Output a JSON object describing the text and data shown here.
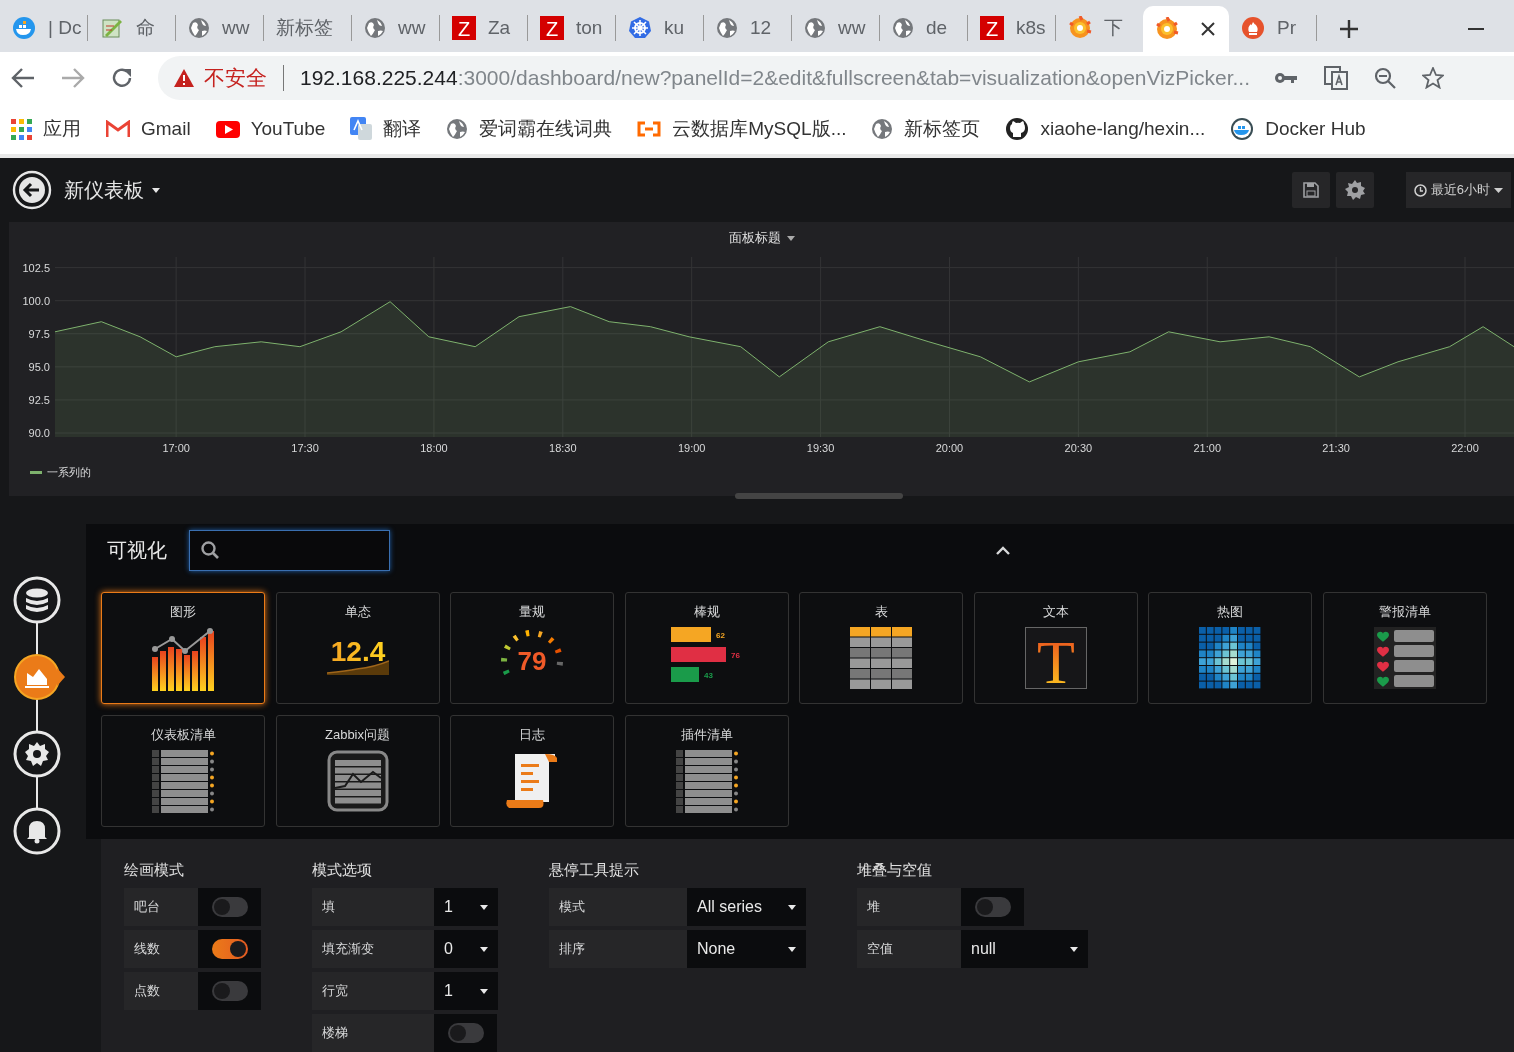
{
  "browser": {
    "tabs": [
      {
        "label": "| Dc",
        "kind": "docker",
        "selected": false
      },
      {
        "label": "命",
        "kind": "pencil",
        "selected": false
      },
      {
        "label": "ww",
        "kind": "globe",
        "selected": false
      },
      {
        "label": "新标签",
        "kind": "blank",
        "selected": false
      },
      {
        "label": "ww",
        "kind": "globe",
        "selected": false
      },
      {
        "label": "Za",
        "kind": "zabbix",
        "icon_text": "Z",
        "selected": false
      },
      {
        "label": "ton",
        "kind": "zabbix",
        "icon_text": "Z",
        "selected": false
      },
      {
        "label": "ku",
        "kind": "kube",
        "selected": false
      },
      {
        "label": "12",
        "kind": "globe",
        "selected": false
      },
      {
        "label": "ww",
        "kind": "globe",
        "selected": false
      },
      {
        "label": "de",
        "kind": "globe",
        "selected": false
      },
      {
        "label": "k8s",
        "kind": "zabbix",
        "icon_text": "Z",
        "selected": false
      },
      {
        "label": "下",
        "kind": "grafana",
        "selected": false
      },
      {
        "kind": "grafana",
        "selected": true
      },
      {
        "label": "Pr",
        "kind": "prometheus",
        "selected": false
      }
    ],
    "address": {
      "security_label": "不安全",
      "host": "192.168.225.244",
      "path": ":3000/dashboard/new?panelId=2&edit&fullscreen&tab=visualization&openVizPicker..."
    },
    "bookmarks": [
      {
        "label": "应用",
        "kind": "apps"
      },
      {
        "label": "Gmail",
        "kind": "gmail"
      },
      {
        "label": "YouTube",
        "kind": "youtube"
      },
      {
        "label": "翻译",
        "kind": "translate"
      },
      {
        "label": "爱词霸在线词典",
        "kind": "globe"
      },
      {
        "label": "云数据库MySQL版...",
        "kind": "cloud"
      },
      {
        "label": "新标签页",
        "kind": "globe"
      },
      {
        "label": "xiaohe-lang/hexin...",
        "kind": "github"
      },
      {
        "label": "Docker Hub",
        "kind": "docker"
      }
    ]
  },
  "dashboard": {
    "title": "新仪表板",
    "time_range": "最近6小时"
  },
  "panel": {
    "title": "面板标题",
    "chart_data": {
      "type": "area",
      "grid": true,
      "x": [
        16.53,
        16.71,
        16.86,
        17.0,
        17.15,
        17.33,
        17.48,
        17.64,
        17.83,
        17.98,
        18.16,
        18.33,
        18.53,
        18.68,
        18.84,
        18.99,
        19.19,
        19.34,
        19.53,
        19.73,
        19.92,
        20.12,
        20.31,
        20.5,
        20.7,
        20.85,
        21.05,
        21.24,
        21.4,
        21.59,
        21.74,
        21.94,
        22.07,
        22.19
      ],
      "series": [
        {
          "name": "一系列的",
          "color": "#7eb26d",
          "values": [
            97.65,
            98.41,
            97.27,
            95.76,
            96.52,
            96.89,
            96.52,
            97.65,
            99.92,
            97.27,
            96.52,
            98.79,
            99.55,
            98.41,
            98.03,
            97.27,
            96.52,
            94.24,
            96.89,
            98.03,
            96.89,
            95.76,
            93.86,
            95.38,
            96.14,
            97.65,
            96.89,
            97.27,
            96.52,
            94.24,
            95.38,
            96.52,
            98.03,
            96.52
          ]
        }
      ],
      "xlim": [
        16.53,
        22.19
      ],
      "ylim": [
        89.7,
        103.3
      ],
      "xticks": [
        {
          "value": 17,
          "label": "17:00"
        },
        {
          "value": 17.5,
          "label": "17:30"
        },
        {
          "value": 18,
          "label": "18:00"
        },
        {
          "value": 18.5,
          "label": "18:30"
        },
        {
          "value": 19,
          "label": "19:00"
        },
        {
          "value": 19.5,
          "label": "19:30"
        },
        {
          "value": 20,
          "label": "20:00"
        },
        {
          "value": 20.5,
          "label": "20:30"
        },
        {
          "value": 21,
          "label": "21:00"
        },
        {
          "value": 21.5,
          "label": "21:30"
        },
        {
          "value": 22,
          "label": "22:00"
        }
      ],
      "yticks": [
        {
          "value": 90,
          "label": "90.0"
        },
        {
          "value": 92.5,
          "label": "92.5"
        },
        {
          "value": 95,
          "label": "95.0"
        },
        {
          "value": 97.5,
          "label": "97.5"
        },
        {
          "value": 100,
          "label": "100.0"
        },
        {
          "value": 102.5,
          "label": "102.5"
        }
      ]
    }
  },
  "editor": {
    "sidebar": [
      {
        "kind": "queries",
        "selected": false
      },
      {
        "kind": "visualization",
        "selected": true
      },
      {
        "kind": "general",
        "selected": false
      },
      {
        "kind": "alert",
        "selected": false
      }
    ],
    "heading": "可视化",
    "visualizations": [
      {
        "label": "图形",
        "kind": "graph",
        "selected": true
      },
      {
        "label": "单态",
        "kind": "singlestat",
        "icon_texts": [
          "12.4"
        ],
        "selected": false
      },
      {
        "label": "量规",
        "kind": "gauge",
        "icon_texts": [
          "79"
        ],
        "selected": false
      },
      {
        "label": "棒规",
        "kind": "bargauge",
        "icon_texts": [
          "62",
          "76",
          "43"
        ],
        "selected": false
      },
      {
        "label": "表",
        "kind": "table",
        "selected": false
      },
      {
        "label": "文本",
        "kind": "text",
        "icon_texts": [
          "T"
        ],
        "selected": false
      },
      {
        "label": "热图",
        "kind": "heatmap",
        "selected": false
      },
      {
        "label": "警报清单",
        "kind": "alertlist",
        "selected": false
      },
      {
        "label": "仪表板清单",
        "kind": "dashlist",
        "selected": false
      },
      {
        "label": "Zabbix问题",
        "kind": "zabbix",
        "selected": false
      },
      {
        "label": "日志",
        "kind": "logs",
        "selected": false
      },
      {
        "label": "插件清单",
        "kind": "pluginlist",
        "selected": false
      }
    ],
    "options": [
      {
        "title": "绘画模式",
        "rows": [
          {
            "label": "吧台",
            "kind": "switch",
            "on": false
          },
          {
            "label": "线数",
            "kind": "switch",
            "on": true
          },
          {
            "label": "点数",
            "kind": "switch",
            "on": false
          }
        ]
      },
      {
        "title": "模式选项",
        "rows": [
          {
            "label": "填",
            "kind": "select",
            "value": "1"
          },
          {
            "label": "填充渐变",
            "kind": "select",
            "value": "0"
          },
          {
            "label": "行宽",
            "kind": "select",
            "value": "1"
          },
          {
            "label": "楼梯",
            "kind": "switch",
            "on": false
          }
        ]
      },
      {
        "title": "悬停工具提示",
        "rows": [
          {
            "label": "模式",
            "kind": "select",
            "value": "All series"
          },
          {
            "label": "排序",
            "kind": "select",
            "value": "None"
          }
        ]
      },
      {
        "title": "堆叠与空值",
        "rows": [
          {
            "label": "堆",
            "kind": "switch",
            "on": false
          },
          {
            "label": "空值",
            "kind": "select",
            "value": "null"
          }
        ]
      }
    ]
  }
}
